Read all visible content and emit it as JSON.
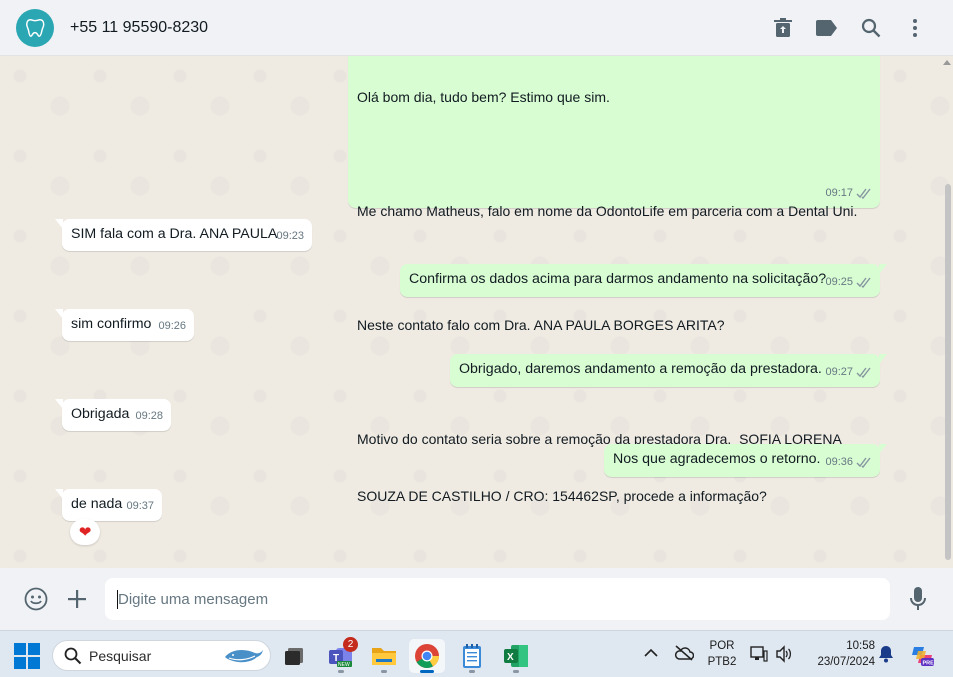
{
  "header": {
    "contact_name": "+55 11 95590-8230",
    "actions": [
      "delete-icon",
      "label-icon",
      "search-icon",
      "menu-icon"
    ]
  },
  "messages": [
    {
      "direction": "out",
      "lines": [
        "Olá bom dia, tudo bem? Estimo que sim.",
        "",
        "Me chamo Matheus, falo em nome da OdontoLife em parceria com a Dental Uni.",
        "",
        "Neste contato falo com Dra. ANA PAULA BORGES ARITA?",
        "",
        "Motivo do contato seria sobre a remoção da prestadora Dra.  SOFIA LORENA",
        "SOUZA DE CASTILHO / CRO: 154462SP, procede a informação?"
      ],
      "time": "09:17"
    },
    {
      "direction": "in",
      "text": "SIM fala com a Dra. ANA PAULA",
      "time": "09:23"
    },
    {
      "direction": "out",
      "text": "Confirma os dados acima para darmos andamento na solicitação?",
      "time": "09:25"
    },
    {
      "direction": "in",
      "text": "sim confirmo",
      "time": "09:26"
    },
    {
      "direction": "out",
      "text": "Obrigado, daremos andamento a remoção da prestadora.",
      "time": "09:27"
    },
    {
      "direction": "in",
      "text": "Obrigada",
      "time": "09:28"
    },
    {
      "direction": "out",
      "text": "Nos que agradecemos o retorno.",
      "time": "09:36"
    },
    {
      "direction": "in",
      "text": "de nada",
      "time": "09:37",
      "reaction": "❤"
    }
  ],
  "composer": {
    "placeholder": "Digite uma mensagem"
  },
  "taskbar": {
    "search_label": "Pesquisar",
    "teams_badge": "2",
    "language": "POR",
    "layout": "PTB2",
    "time": "10:58",
    "date": "23/07/2024"
  },
  "colors": {
    "outgoing_bubble": "#d9fdd3",
    "incoming_bubble": "#ffffff",
    "chat_background": "#efeae2",
    "read_ticks": "#8696a0"
  }
}
